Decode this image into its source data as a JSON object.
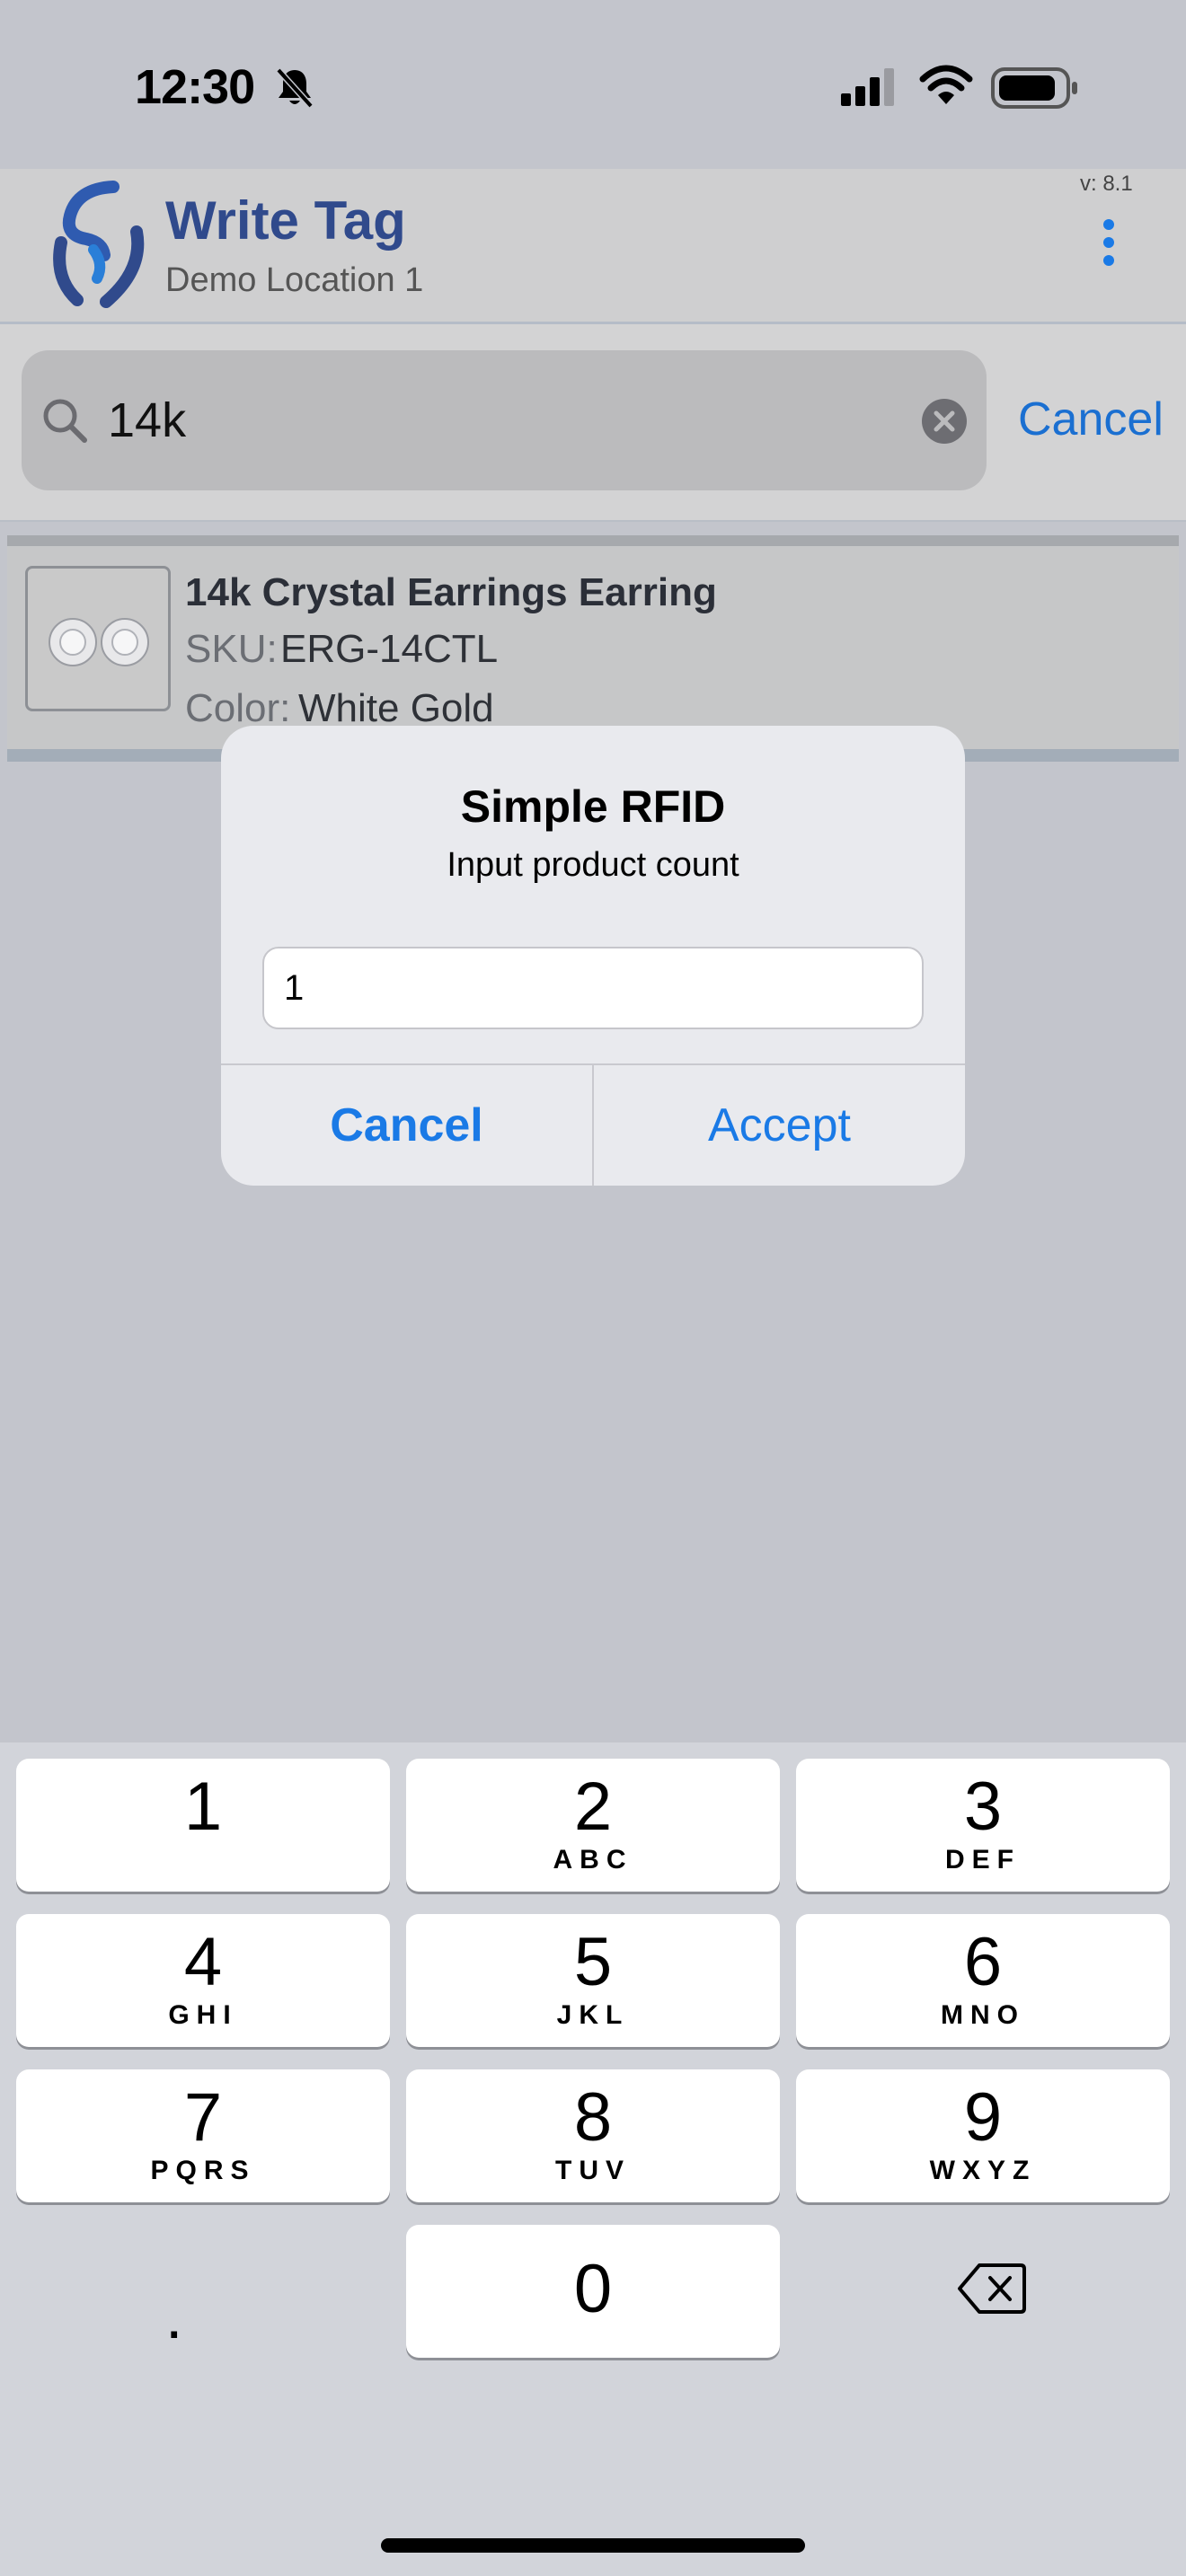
{
  "status_bar": {
    "time": "12:30"
  },
  "header": {
    "title": "Write Tag",
    "subtitle": "Demo Location 1",
    "version": "v: 8.1"
  },
  "search": {
    "value": "14k",
    "cancel_label": "Cancel"
  },
  "product": {
    "name": "14k Crystal Earrings Earring",
    "sku_label": "SKU:",
    "sku_value": "ERG-14CTL",
    "color_label": "Color:",
    "color_value": "White Gold"
  },
  "dialog": {
    "title": "Simple RFID",
    "message": "Input product count",
    "input_value": "1",
    "cancel_label": "Cancel",
    "accept_label": "Accept"
  },
  "keyboard": {
    "keys": [
      {
        "digit": "1",
        "letters": ""
      },
      {
        "digit": "2",
        "letters": "ABC"
      },
      {
        "digit": "3",
        "letters": "DEF"
      },
      {
        "digit": "4",
        "letters": "GHI"
      },
      {
        "digit": "5",
        "letters": "JKL"
      },
      {
        "digit": "6",
        "letters": "MNO"
      },
      {
        "digit": "7",
        "letters": "PQRS"
      },
      {
        "digit": "8",
        "letters": "TUV"
      },
      {
        "digit": "9",
        "letters": "WXYZ"
      },
      {
        "digit": "0",
        "letters": ""
      }
    ],
    "decimal": "."
  },
  "colors": {
    "accent": "#1a7ae6",
    "brand": "#304a8c"
  },
  "icons": [
    "bell-slash-icon",
    "signal-icon",
    "wifi-icon",
    "battery-icon",
    "app-logo-icon",
    "more-vertical-icon",
    "search-icon",
    "clear-icon",
    "backspace-icon"
  ]
}
